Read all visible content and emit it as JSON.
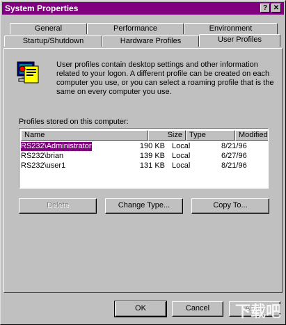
{
  "window": {
    "title": "System Properties",
    "help_glyph": "?",
    "close_glyph": "✕"
  },
  "tabs": {
    "general": "General",
    "performance": "Performance",
    "environment": "Environment",
    "startup": "Startup/Shutdown",
    "hardware": "Hardware Profiles",
    "user_profiles": "User Profiles"
  },
  "description": "User profiles contain desktop settings and other information related to your logon. A different profile can be created on each computer you use, or you can select a roaming profile that is the same on every computer you use.",
  "list": {
    "label": "Profiles stored on this computer:",
    "headers": {
      "name": "Name",
      "size": "Size",
      "type": "Type",
      "modified": "Modified"
    },
    "rows": [
      {
        "name": "RS232\\Administrator",
        "size": "190 KB",
        "type": "Local",
        "modified": "8/21/96"
      },
      {
        "name": "RS232\\brian",
        "size": "139 KB",
        "type": "Local",
        "modified": "6/27/96"
      },
      {
        "name": "RS232\\user1",
        "size": "131 KB",
        "type": "Local",
        "modified": "8/21/96"
      }
    ]
  },
  "buttons": {
    "delete": "Delete",
    "change_type": "Change Type...",
    "copy_to": "Copy To...",
    "ok": "OK",
    "cancel": "Cancel",
    "apply": "Apply"
  },
  "watermark": "下载吧",
  "colors": {
    "titlebar": "#800080",
    "selection": "#800080",
    "face": "#c0c0c0"
  },
  "icons": {
    "profiles": "user-profiles-icon"
  }
}
